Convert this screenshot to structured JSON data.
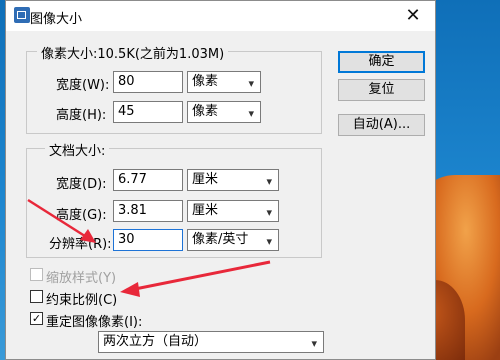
{
  "window": {
    "title": "图像大小",
    "close_glyph": "✕"
  },
  "pixel_dimensions": {
    "legend": "像素大小:10.5K(之前为1.03M)",
    "width": {
      "label": "宽度(W):",
      "value": "80",
      "unit": "像素"
    },
    "height": {
      "label": "高度(H):",
      "value": "45",
      "unit": "像素"
    }
  },
  "document_size": {
    "legend": "文档大小:",
    "width": {
      "label": "宽度(D):",
      "value": "6.77",
      "unit": "厘米"
    },
    "height": {
      "label": "高度(G):",
      "value": "3.81",
      "unit": "厘米"
    },
    "resolution": {
      "label": "分辨率(R):",
      "value": "30",
      "unit": "像素/英寸"
    }
  },
  "options": {
    "scale_styles": {
      "label": "缩放样式(Y)",
      "checked": false,
      "enabled": false
    },
    "constrain_proportions": {
      "label": "约束比例(C)",
      "checked": false
    },
    "resample": {
      "label": "重定图像像素(I):",
      "checked": true,
      "method": "两次立方（自动）"
    }
  },
  "buttons": {
    "ok": "确定",
    "reset": "复位",
    "auto": "自动(A)..."
  },
  "annotation": {
    "color": "#e8283a"
  },
  "icons": {
    "dropdown": "▾",
    "check": "✓"
  }
}
